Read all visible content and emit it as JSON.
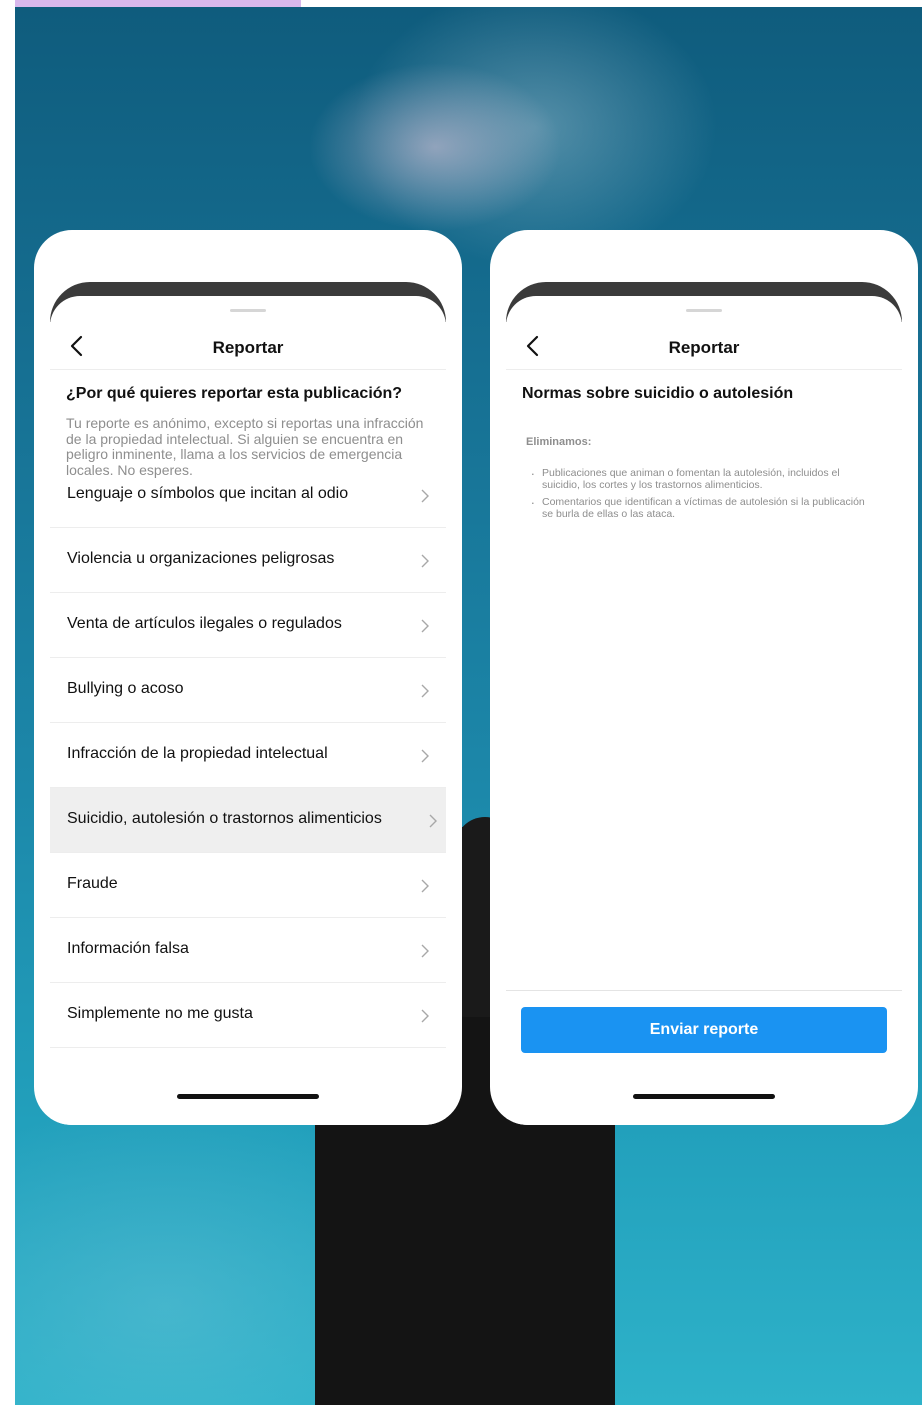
{
  "left_phone": {
    "title": "Reportar",
    "question": "¿Por qué quieres reportar esta publicación?",
    "intro": "Tu reporte es anónimo, excepto si reportas una infracción de la propiedad intelectual. Si alguien se encuentra en peligro inminente, llama a los servicios de emergencia locales. No esperes.",
    "options": [
      "Lenguaje o símbolos que incitan al odio",
      "Violencia u organizaciones peligrosas",
      "Venta de artículos ilegales o regulados",
      "Bullying o acoso",
      "Infracción de la propiedad intelectual",
      "Suicidio, autolesión o trastornos alimenticios",
      "Fraude",
      "Información falsa",
      "Simplemente no me gusta"
    ],
    "selected_option": "Suicidio, autolesión o trastornos alimenticios"
  },
  "right_phone": {
    "title": "Reportar",
    "section_title": "Normas sobre suicidio o autolesión",
    "eliminamos_label": "Eliminamos:",
    "bullets": [
      "Publicaciones que animan o fomentan la autolesión, incluidos el suicidio, los cortes y los trastornos alimenticios.",
      "Comentarios que identifican a víctimas de autolesión si la publicación se burla de ellas o las ataca."
    ],
    "submit_label": "Enviar reporte"
  },
  "colors": {
    "accent_tab": "#d9b8ec",
    "submit_button": "#1a93f2",
    "selected_row": "#efefef"
  },
  "icons": [
    "back-arrow-icon",
    "chevron-right-icon"
  ]
}
